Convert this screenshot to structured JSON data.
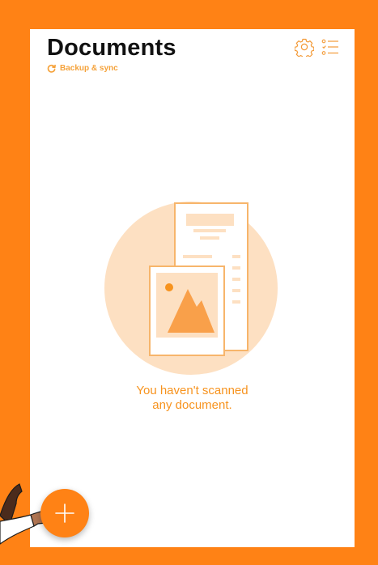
{
  "header": {
    "title": "Documents",
    "sync_label": "Backup & sync"
  },
  "icons": {
    "sync": "sync-icon",
    "settings": "gear-icon",
    "tasks": "checklist-icon",
    "add": "plus-icon"
  },
  "empty_state": {
    "line1": "You haven't scanned",
    "line2": "any document."
  },
  "colors": {
    "accent": "#ff8215",
    "accent_text": "#f7931e",
    "illustration_light": "#fde0c2",
    "title": "#111111"
  }
}
